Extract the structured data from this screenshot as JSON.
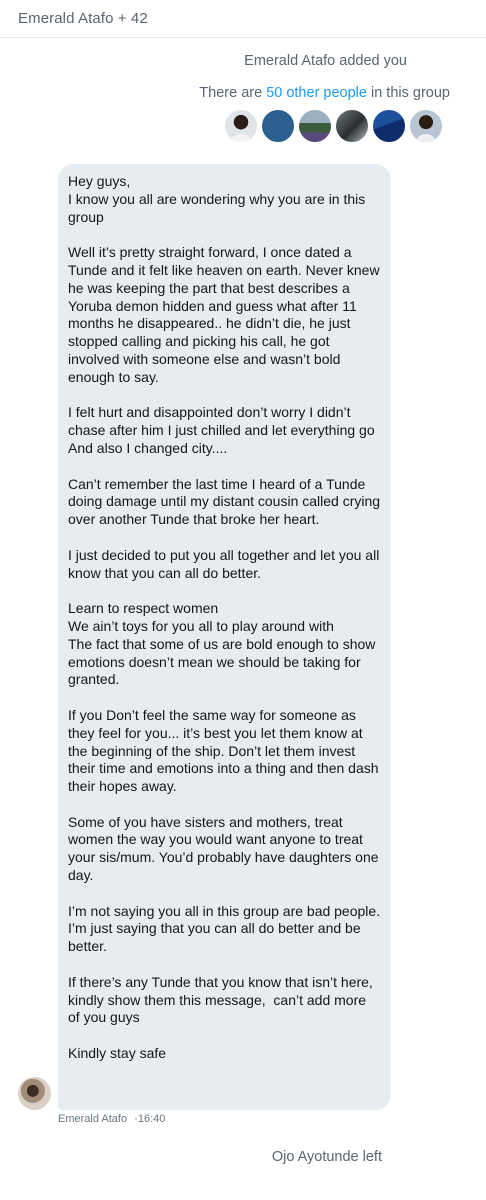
{
  "header": {
    "title": "Emerald Atafo + 42"
  },
  "system_messages": {
    "added": "Emerald Atafo added you",
    "count_prefix": "There are ",
    "count_link": "50 other people",
    "count_suffix": " in this group",
    "left": "Ojo Ayotunde left"
  },
  "member_avatars": [
    "avatar-1",
    "avatar-2",
    "avatar-3",
    "avatar-4",
    "avatar-5",
    "avatar-6"
  ],
  "message": {
    "sender": "Emerald Atafo",
    "separator": "·",
    "time": "16:40",
    "text": "Hey guys,\nI know you all are wondering why you are in this group\n\nWell it’s pretty straight forward, I once dated a Tunde and it felt like heaven on earth. Never knew he was keeping the part that best describes a Yoruba demon hidden and guess what after 11 months he disappeared.. he didn’t die, he just stopped calling and picking his call, he got involved with someone else and wasn’t bold enough to say.\n\nI felt hurt and disappointed don’t worry I didn’t chase after him I just chilled and let everything go\nAnd also I changed city....\n\nCan’t remember the last time I heard of a Tunde doing damage until my distant cousin called crying over another Tunde that broke her heart.\n\nI just decided to put you all together and let you all know that you can all do better.\n\nLearn to respect women\nWe ain’t toys for you all to play around with\nThe fact that some of us are bold enough to show emotions doesn’t mean we should be taking for granted.\n\nIf you Don’t feel the same way for someone as they feel for you... it’s best you let them know at the beginning of the ship. Don’t let them invest their time and emotions into a thing and then dash their hopes away.\n\nSome of you have sisters and mothers, treat women the way you would want anyone to treat your sis/mum. You’d probably have daughters one day.\n\nI’m not saying you all in this group are bad people.\nI’m just saying that you can all do better and be better.\n\nIf there’s any Tunde that you know that isn’t here, kindly show them this message,  can’t add more of you guys\n\nKindly stay safe"
  },
  "colors": {
    "bubble": "#e6ecf0",
    "link": "#1d9bf0",
    "muted": "#5b6470"
  }
}
